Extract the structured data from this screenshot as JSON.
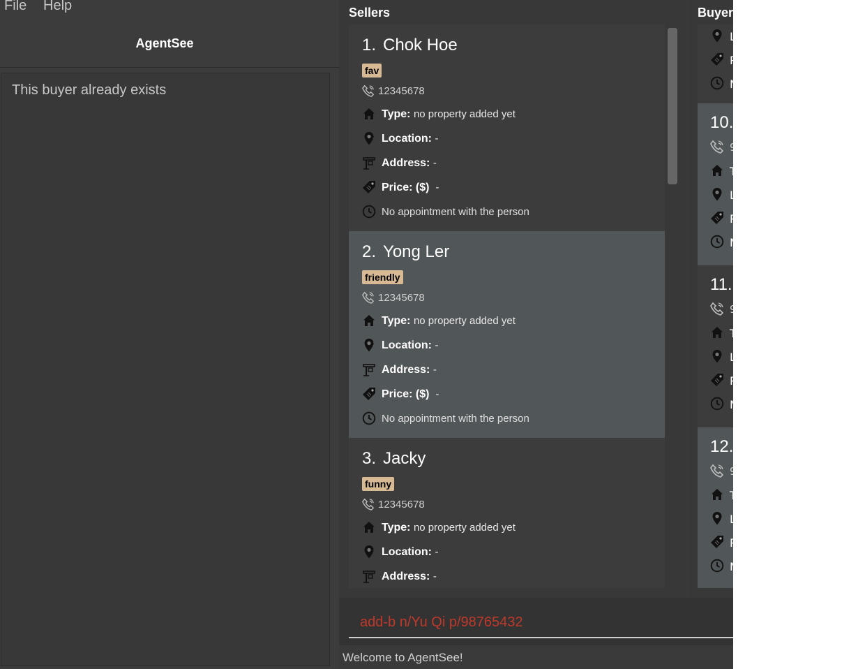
{
  "menu": {
    "file": "File",
    "help": "Help"
  },
  "app_title": "AgentSee",
  "result_message": "This buyer already exists",
  "sellers": {
    "title": "Sellers",
    "labels": {
      "type": "Type:",
      "location": "Location:",
      "address": "Address:",
      "price": "Price: ($)"
    },
    "cards": [
      {
        "index": "1.",
        "name": "Chok Hoe",
        "tag": "fav",
        "phone": "12345678",
        "type": "no property added yet",
        "location": "-",
        "address": "-",
        "price": "-",
        "appointment": "No appointment with the person"
      },
      {
        "index": "2.",
        "name": "Yong Ler",
        "tag": "friendly",
        "phone": "12345678",
        "type": "no property added yet",
        "location": "-",
        "address": "-",
        "price": "-",
        "appointment": "No appointment with the person"
      },
      {
        "index": "3.",
        "name": "Jacky",
        "tag": "funny",
        "phone": "12345678",
        "type": "no property added yet",
        "location": "-",
        "address": "-"
      }
    ]
  },
  "buyers": {
    "title": "Buyer",
    "top_partial": [
      {
        "letter": "L"
      },
      {
        "letter": "P"
      },
      {
        "letter": "N"
      }
    ],
    "cards": [
      {
        "index": "10.",
        "phone": "9",
        "type": "T",
        "location": "L",
        "price": "P",
        "appointment": "N"
      },
      {
        "index": "11.",
        "phone": "9",
        "type": "T",
        "location": "L",
        "price": "P",
        "appointment": "N"
      },
      {
        "index": "12.",
        "phone": "9",
        "type": "T",
        "location": "L",
        "price": "P",
        "appointment": "N"
      }
    ]
  },
  "command": {
    "value": "add-b n/Yu Qi p/98765432"
  },
  "status": "Welcome to AgentSee!",
  "colors": {
    "tag_bg": "#d7b994",
    "command_text": "#c0392b",
    "selected_card": "#515658"
  },
  "icons": [
    "phone-icon",
    "home-icon",
    "location-pin-icon",
    "signpost-icon",
    "price-tag-icon",
    "clock-icon"
  ]
}
